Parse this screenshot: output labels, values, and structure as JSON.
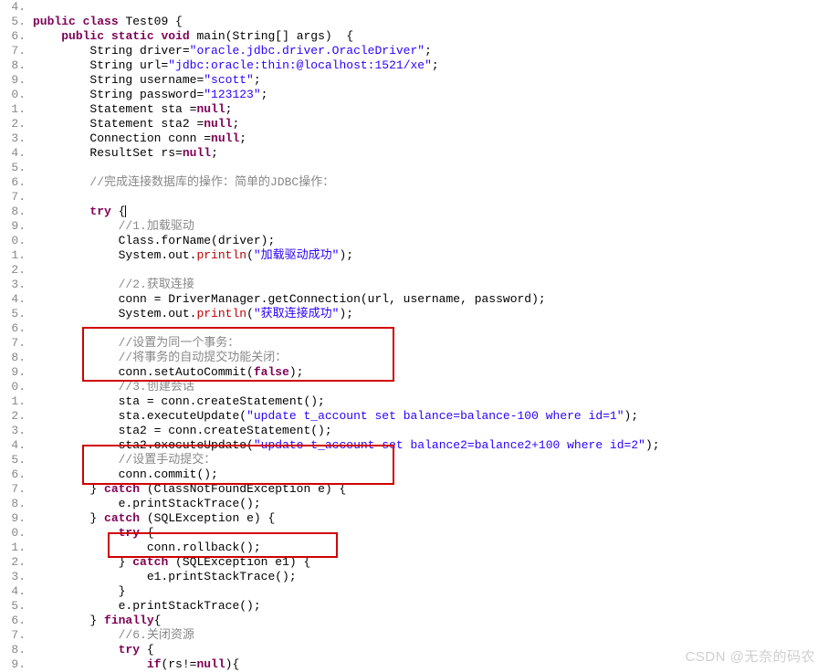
{
  "watermark": "CSDN @无奈的码农",
  "lines": [
    {
      "n": "4.",
      "indent": 0,
      "tokens": []
    },
    {
      "n": "5.",
      "indent": 0,
      "tokens": [
        {
          "t": "public",
          "c": "kw"
        },
        {
          "t": " ",
          "c": ""
        },
        {
          "t": "class",
          "c": "kw"
        },
        {
          "t": " Test09 {",
          "c": ""
        }
      ]
    },
    {
      "n": "6.",
      "indent": 1,
      "tokens": [
        {
          "t": "public",
          "c": "kw"
        },
        {
          "t": " ",
          "c": ""
        },
        {
          "t": "static",
          "c": "kw"
        },
        {
          "t": " ",
          "c": ""
        },
        {
          "t": "void",
          "c": "kw"
        },
        {
          "t": " main(String[] args)  {",
          "c": ""
        }
      ]
    },
    {
      "n": "7.",
      "indent": 2,
      "tokens": [
        {
          "t": "String driver=",
          "c": ""
        },
        {
          "t": "\"oracle.jdbc.driver.OracleDriver\"",
          "c": "str"
        },
        {
          "t": ";",
          "c": ""
        }
      ]
    },
    {
      "n": "8.",
      "indent": 2,
      "tokens": [
        {
          "t": "String url=",
          "c": ""
        },
        {
          "t": "\"jdbc:oracle:thin:@localhost:1521/xe\"",
          "c": "str"
        },
        {
          "t": ";",
          "c": ""
        }
      ]
    },
    {
      "n": "9.",
      "indent": 2,
      "tokens": [
        {
          "t": "String username=",
          "c": ""
        },
        {
          "t": "\"scott\"",
          "c": "str"
        },
        {
          "t": ";",
          "c": ""
        }
      ]
    },
    {
      "n": "0.",
      "indent": 2,
      "tokens": [
        {
          "t": "String password=",
          "c": ""
        },
        {
          "t": "\"123123\"",
          "c": "str"
        },
        {
          "t": ";",
          "c": ""
        }
      ]
    },
    {
      "n": "1.",
      "indent": 2,
      "tokens": [
        {
          "t": "Statement sta =",
          "c": ""
        },
        {
          "t": "null",
          "c": "kw"
        },
        {
          "t": ";",
          "c": ""
        }
      ]
    },
    {
      "n": "2.",
      "indent": 2,
      "tokens": [
        {
          "t": "Statement sta2 =",
          "c": ""
        },
        {
          "t": "null",
          "c": "kw"
        },
        {
          "t": ";",
          "c": ""
        }
      ]
    },
    {
      "n": "3.",
      "indent": 2,
      "tokens": [
        {
          "t": "Connection conn =",
          "c": ""
        },
        {
          "t": "null",
          "c": "kw"
        },
        {
          "t": ";",
          "c": ""
        }
      ]
    },
    {
      "n": "4.",
      "indent": 2,
      "tokens": [
        {
          "t": "ResultSet rs=",
          "c": ""
        },
        {
          "t": "null",
          "c": "kw"
        },
        {
          "t": ";",
          "c": ""
        }
      ]
    },
    {
      "n": "5.",
      "indent": 0,
      "tokens": []
    },
    {
      "n": "6.",
      "indent": 2,
      "tokens": [
        {
          "t": "//完成连接数据库的操作：简单的JDBC操作：",
          "c": "comm"
        }
      ]
    },
    {
      "n": "7.",
      "indent": 0,
      "tokens": []
    },
    {
      "n": "8.",
      "indent": 2,
      "tokens": [
        {
          "t": "try",
          "c": "kw"
        },
        {
          "t": " {",
          "c": ""
        },
        {
          "t": "|",
          "c": "cursor"
        }
      ]
    },
    {
      "n": "9.",
      "indent": 3,
      "tokens": [
        {
          "t": "//1.加载驱动",
          "c": "comm"
        }
      ]
    },
    {
      "n": "0.",
      "indent": 3,
      "tokens": [
        {
          "t": "Class.forName(driver);",
          "c": ""
        }
      ]
    },
    {
      "n": "1.",
      "indent": 3,
      "tokens": [
        {
          "t": "System.out.",
          "c": ""
        },
        {
          "t": "println",
          "c": "red"
        },
        {
          "t": "(",
          "c": ""
        },
        {
          "t": "\"加载驱动成功\"",
          "c": "str"
        },
        {
          "t": ");",
          "c": ""
        }
      ]
    },
    {
      "n": "2.",
      "indent": 0,
      "tokens": []
    },
    {
      "n": "3.",
      "indent": 3,
      "tokens": [
        {
          "t": "//2.获取连接",
          "c": "comm"
        }
      ]
    },
    {
      "n": "4.",
      "indent": 3,
      "tokens": [
        {
          "t": "conn = DriverManager.getConnection(url, username, password);",
          "c": ""
        }
      ]
    },
    {
      "n": "5.",
      "indent": 3,
      "tokens": [
        {
          "t": "System.out.",
          "c": ""
        },
        {
          "t": "println",
          "c": "red"
        },
        {
          "t": "(",
          "c": ""
        },
        {
          "t": "\"获取连接成功\"",
          "c": "str"
        },
        {
          "t": ");",
          "c": ""
        }
      ]
    },
    {
      "n": "6.",
      "indent": 0,
      "tokens": []
    },
    {
      "n": "7.",
      "indent": 3,
      "tokens": [
        {
          "t": "//设置为同一个事务：",
          "c": "comm"
        }
      ]
    },
    {
      "n": "8.",
      "indent": 3,
      "tokens": [
        {
          "t": "//将事务的自动提交功能关闭：",
          "c": "comm"
        }
      ]
    },
    {
      "n": "9.",
      "indent": 3,
      "tokens": [
        {
          "t": "conn.setAutoCommit(",
          "c": ""
        },
        {
          "t": "false",
          "c": "kw"
        },
        {
          "t": ");",
          "c": ""
        }
      ]
    },
    {
      "n": "0.",
      "indent": 3,
      "tokens": [
        {
          "t": "//3.创建会话",
          "c": "comm"
        }
      ]
    },
    {
      "n": "1.",
      "indent": 3,
      "tokens": [
        {
          "t": "sta = conn.createStatement();",
          "c": ""
        }
      ]
    },
    {
      "n": "2.",
      "indent": 3,
      "tokens": [
        {
          "t": "sta.executeUpdate(",
          "c": ""
        },
        {
          "t": "\"update t_account set balance=balance-100 where id=1\"",
          "c": "str"
        },
        {
          "t": ");",
          "c": ""
        }
      ]
    },
    {
      "n": "3.",
      "indent": 3,
      "tokens": [
        {
          "t": "sta2 = conn.createStatement();",
          "c": ""
        }
      ]
    },
    {
      "n": "4.",
      "indent": 3,
      "tokens": [
        {
          "t": "sta2.executeUpdate(",
          "c": ""
        },
        {
          "t": "\"update t_account set balance2=balance2+100 where id=2\"",
          "c": "str"
        },
        {
          "t": ");",
          "c": ""
        }
      ]
    },
    {
      "n": "5.",
      "indent": 3,
      "tokens": [
        {
          "t": "//设置手动提交：",
          "c": "comm"
        }
      ]
    },
    {
      "n": "6.",
      "indent": 3,
      "tokens": [
        {
          "t": "conn.commit();",
          "c": ""
        }
      ]
    },
    {
      "n": "7.",
      "indent": 2,
      "tokens": [
        {
          "t": "} ",
          "c": ""
        },
        {
          "t": "catch",
          "c": "kw"
        },
        {
          "t": " (ClassNotFoundException e) {",
          "c": ""
        }
      ]
    },
    {
      "n": "8.",
      "indent": 3,
      "tokens": [
        {
          "t": "e.printStackTrace();",
          "c": ""
        }
      ]
    },
    {
      "n": "9.",
      "indent": 2,
      "tokens": [
        {
          "t": "} ",
          "c": ""
        },
        {
          "t": "catch",
          "c": "kw"
        },
        {
          "t": " (SQLException e) {",
          "c": ""
        }
      ]
    },
    {
      "n": "0.",
      "indent": 3,
      "tokens": [
        {
          "t": "try",
          "c": "kw"
        },
        {
          "t": " {",
          "c": ""
        }
      ]
    },
    {
      "n": "1.",
      "indent": 4,
      "tokens": [
        {
          "t": "conn.rollback();",
          "c": ""
        }
      ]
    },
    {
      "n": "2.",
      "indent": 3,
      "tokens": [
        {
          "t": "} ",
          "c": ""
        },
        {
          "t": "catch",
          "c": "kw"
        },
        {
          "t": " (SQLException e1) {",
          "c": ""
        }
      ]
    },
    {
      "n": "3.",
      "indent": 4,
      "tokens": [
        {
          "t": "e1.printStackTrace();",
          "c": ""
        }
      ]
    },
    {
      "n": "4.",
      "indent": 3,
      "tokens": [
        {
          "t": "}",
          "c": ""
        }
      ]
    },
    {
      "n": "5.",
      "indent": 3,
      "tokens": [
        {
          "t": "e.printStackTrace();",
          "c": ""
        }
      ]
    },
    {
      "n": "6.",
      "indent": 2,
      "tokens": [
        {
          "t": "} ",
          "c": ""
        },
        {
          "t": "finally",
          "c": "kw"
        },
        {
          "t": "{",
          "c": ""
        }
      ]
    },
    {
      "n": "7.",
      "indent": 3,
      "tokens": [
        {
          "t": "//6.关闭资源",
          "c": "comm"
        }
      ]
    },
    {
      "n": "8.",
      "indent": 3,
      "tokens": [
        {
          "t": "try",
          "c": "kw"
        },
        {
          "t": " {",
          "c": ""
        }
      ]
    },
    {
      "n": "9.",
      "indent": 4,
      "tokens": [
        {
          "t": "if",
          "c": "kw"
        },
        {
          "t": "(rs!=",
          "c": ""
        },
        {
          "t": "null",
          "c": "kw"
        },
        {
          "t": "){",
          "c": ""
        }
      ]
    }
  ],
  "indent_unit": "    "
}
